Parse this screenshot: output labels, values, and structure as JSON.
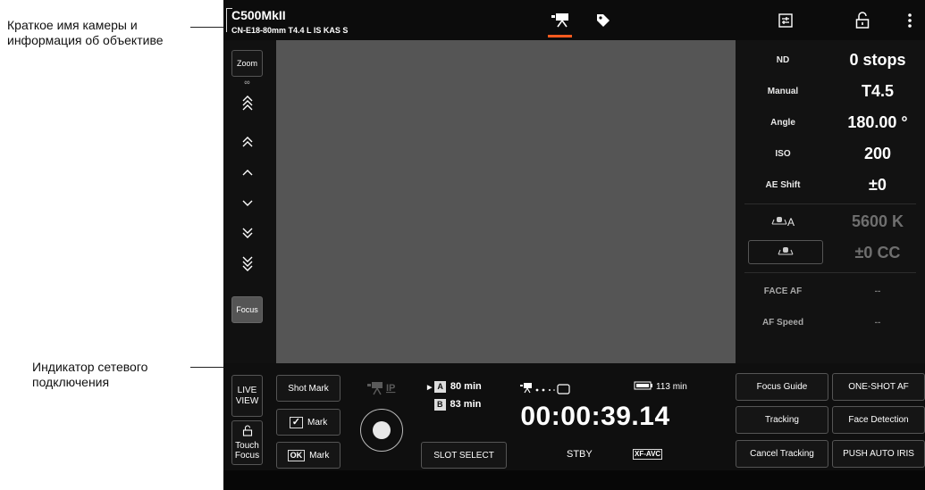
{
  "callouts": {
    "camera_name": "Краткое имя камеры и информация об объективе",
    "network": "Индикатор сетевого подключения"
  },
  "header": {
    "camera_name": "C500MkII",
    "lens_info": "CN-E18-80mm T4.4 L IS KAS S",
    "active_tab": "camera-icon",
    "icons": [
      "camera-icon",
      "tag-icon",
      "settings-sliders-icon",
      "unlock-icon",
      "more-vertical-icon"
    ]
  },
  "lens_rocker": {
    "zoom_label": "Zoom",
    "focus_label": "Focus",
    "infinity": "∞"
  },
  "settings": [
    {
      "label": "ND",
      "value": "0 stops"
    },
    {
      "label": "Manual",
      "value": "T4.5"
    },
    {
      "label": "Angle",
      "value": "180.00 °"
    },
    {
      "label": "ISO",
      "value": "200"
    },
    {
      "label": "AE Shift",
      "value": "±0"
    }
  ],
  "white_balance": {
    "wb_label_suffix": "A",
    "kelvin": "5600 K",
    "cc": "±0 CC"
  },
  "af": [
    {
      "label": "FACE AF",
      "value": "--"
    },
    {
      "label": "AF Speed",
      "value": "--"
    }
  ],
  "bottom": {
    "live_view": "LIVE\nVIEW",
    "touch_focus": "Touch\nFocus",
    "shot_mark": "Shot Mark",
    "check_mark": "Mark",
    "ok_mark": "Mark",
    "check_symbol": "✓",
    "ok_symbol": "OK",
    "slot_a_label": "A",
    "slot_a_time": "80 min",
    "slot_b_label": "B",
    "slot_b_time": "83 min",
    "slot_select": "SLOT SELECT",
    "timecode": "00:00:39.14",
    "status": "STBY",
    "format": "XF-AVC",
    "battery_time": "113 min"
  },
  "af_buttons": {
    "focus_guide": "Focus Guide",
    "one_shot_af": "ONE-SHOT AF",
    "tracking": "Tracking",
    "face_detection": "Face Detection",
    "cancel_tracking": "Cancel Tracking",
    "push_auto_iris": "PUSH AUTO IRIS"
  },
  "colors": {
    "accent": "#ff5a1f",
    "background": "#111111",
    "viewer": "#555555"
  }
}
